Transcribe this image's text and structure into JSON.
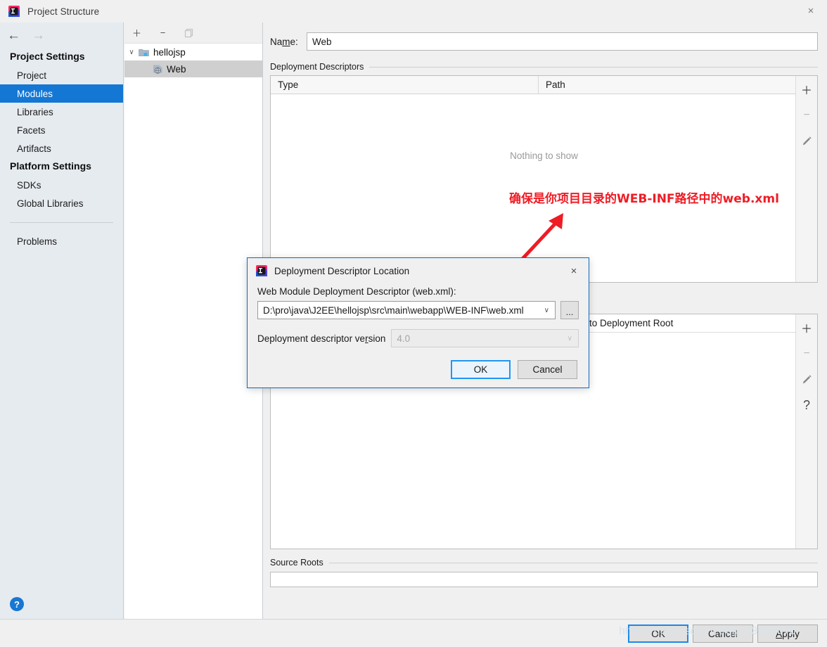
{
  "window": {
    "title": "Project Structure",
    "app_icon": "intellij-idea-logo",
    "close_icon": "×"
  },
  "sidebar": {
    "nav": {
      "back_icon": "←",
      "forward_icon": "→"
    },
    "groups": [
      {
        "title": "Project Settings",
        "items": [
          {
            "label": "Project",
            "selected": false
          },
          {
            "label": "Modules",
            "selected": true
          },
          {
            "label": "Libraries",
            "selected": false
          },
          {
            "label": "Facets",
            "selected": false
          },
          {
            "label": "Artifacts",
            "selected": false
          }
        ]
      },
      {
        "title": "Platform Settings",
        "items": [
          {
            "label": "SDKs",
            "selected": false
          },
          {
            "label": "Global Libraries",
            "selected": false
          }
        ]
      }
    ],
    "problems_label": "Problems",
    "help_icon": "?",
    "selected_color": "#1477d4"
  },
  "tree": {
    "toolbar": [
      {
        "name": "add-module-button",
        "glyph": "＋",
        "enabled": true
      },
      {
        "name": "remove-module-button",
        "glyph": "−",
        "enabled": true
      },
      {
        "name": "copy-module-button",
        "glyph": "❐",
        "enabled": false
      }
    ],
    "nodes": [
      {
        "label": "hellojsp",
        "icon": "module-folder-icon",
        "depth": 0,
        "expanded": true,
        "selected": false
      },
      {
        "label": "Web",
        "icon": "web-facet-icon",
        "depth": 1,
        "expanded": false,
        "selected": true
      }
    ],
    "chevron_expanded": "∨"
  },
  "main": {
    "name_label": "Name:",
    "name_value": "Web",
    "deployment_descriptors": {
      "section_title": "Deployment Descriptors",
      "columns": [
        "Type",
        "Path"
      ],
      "rows": [],
      "empty_text": "Nothing to show",
      "tools": [
        {
          "name": "add-descriptor-button",
          "glyph": "＋",
          "enabled": true
        },
        {
          "name": "remove-descriptor-button",
          "glyph": "−",
          "enabled": false
        },
        {
          "name": "edit-descriptor-button",
          "glyph": "✎",
          "enabled": true
        }
      ]
    },
    "web_resources": {
      "column_partial": "ive to Deployment Root",
      "tools": [
        {
          "name": "add-resource-button",
          "glyph": "＋",
          "enabled": true
        },
        {
          "name": "remove-resource-button",
          "glyph": "−",
          "enabled": false
        },
        {
          "name": "edit-resource-button",
          "glyph": "✎",
          "enabled": true
        },
        {
          "name": "help-resource-button",
          "glyph": "?",
          "enabled": true
        }
      ]
    },
    "source_roots": {
      "section_title": "Source Roots",
      "value": ""
    }
  },
  "bottom_bar": {
    "ok_label": "OK",
    "cancel_label": "Cancel",
    "apply_label": "Apply",
    "apply_mnemonic": "A",
    "watermark": "https://blog.csdn.net/qq_43936670"
  },
  "annotation": {
    "text": "确保是你项目目录的WEB-INF路径中的web.xml",
    "color": "#ef1c25",
    "arrow": "red-arrow-pointing-up-right"
  },
  "dialog": {
    "title": "Deployment Descriptor Location",
    "icon": "intellij-idea-logo",
    "close_icon": "×",
    "descriptor_label": "Web Module Deployment Descriptor (web.xml):",
    "descriptor_path": "D:\\pro\\java\\J2EE\\hellojsp\\src\\main\\webapp\\WEB-INF\\web.xml",
    "browse_label": "...",
    "version_label": "Deployment descriptor version",
    "version_mnemonic": "r",
    "version_value": "4.0",
    "version_enabled": false,
    "ok_label": "OK",
    "cancel_label": "Cancel",
    "caret_icon": "∨"
  }
}
